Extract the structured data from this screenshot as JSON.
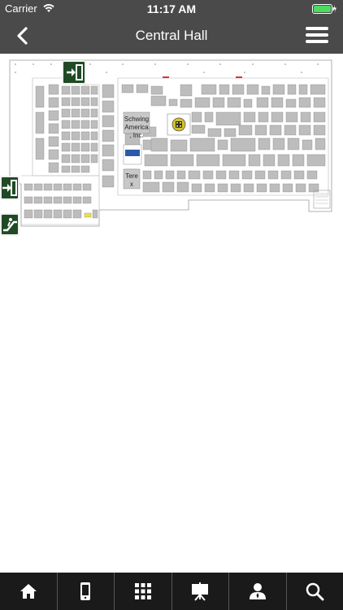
{
  "status": {
    "carrier": "Carrier",
    "time": "11:17 AM",
    "battery_color": "#4cd964"
  },
  "nav": {
    "title": "Central Hall"
  },
  "map": {
    "booths": {
      "schwing": "Schwing America , Inc.",
      "terex": "Tere x"
    },
    "colors": {
      "booth": "#bdbdbd",
      "exit_icon": "#1f4a25",
      "highlight": "#d4c22a"
    }
  },
  "tabs": [
    {
      "name": "home",
      "icon": "home-icon"
    },
    {
      "name": "exhibitors",
      "icon": "phone-icon"
    },
    {
      "name": "categories",
      "icon": "grid-icon"
    },
    {
      "name": "events",
      "icon": "presentation-icon"
    },
    {
      "name": "profile",
      "icon": "user-icon"
    },
    {
      "name": "search",
      "icon": "search-icon"
    }
  ]
}
